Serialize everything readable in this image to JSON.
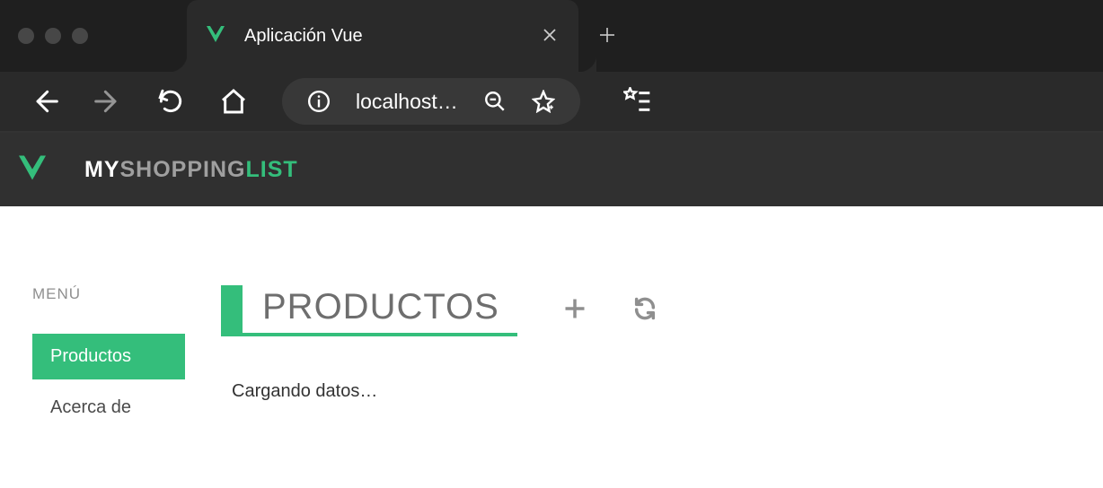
{
  "browser": {
    "tab_title": "Aplicación Vue",
    "address": "localhost…"
  },
  "brand": {
    "part1": "MY",
    "part2": "SHOPPING",
    "part3": "LIST"
  },
  "sidebar": {
    "title": "MENÚ",
    "items": [
      {
        "label": "Productos"
      },
      {
        "label": "Acerca de"
      }
    ]
  },
  "main": {
    "title": "PRODUCTOS",
    "loading_text": "Cargando datos…"
  }
}
